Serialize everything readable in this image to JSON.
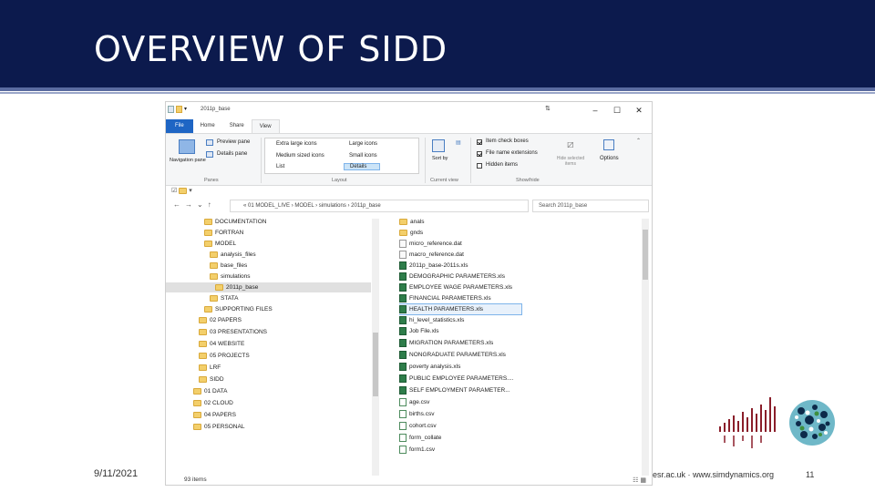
{
  "slide": {
    "title": "OVERVIEW OF SIDD",
    "date": "9/11/2021",
    "footer_text": "esr.ac.uk  ·  www.simdynamics.org",
    "page_number": "11"
  },
  "explorer": {
    "window_title": "2011p_base",
    "window_buttons": [
      "–",
      "☐",
      "✕"
    ],
    "tabs": [
      "File",
      "Home",
      "Share",
      "View"
    ],
    "ribbon": {
      "panes": {
        "navigation_pane": "Navigation pane",
        "preview_pane": "Preview pane",
        "details_pane": "Details pane",
        "group_label": "Panes"
      },
      "layout": {
        "options": [
          "Extra large icons",
          "Large icons",
          "Medium sized icons",
          "Small icons",
          "List",
          "Details"
        ],
        "group_label": "Layout"
      },
      "current_view": {
        "sort": "Sort by",
        "group_label": "Current view"
      },
      "show_hide": {
        "item_check_boxes": "Item check boxes",
        "file_name_extensions": "File name extensions",
        "hidden_items": "Hidden items",
        "hide_selected": "Hide selected items",
        "options": "Options",
        "group_label": "Show/hide"
      }
    },
    "address": "« 01 MODEL_LIVE  ›  MODEL  ›  simulations  ›  2011p_base",
    "search_placeholder": "Search 2011p_base",
    "tree": [
      "DOCUMENTATION",
      "FORTRAN",
      "MODEL",
      "analysis_files",
      "base_files",
      "simulations",
      "2011p_base",
      "STATA",
      "SUPPORTING FILES",
      "02 PAPERS",
      "03 PRESENTATIONS",
      "04 WEBSITE",
      "05 PROJECTS",
      "LRF",
      "SIDD",
      "01 DATA",
      "02 CLOUD",
      "04 PAPERS",
      "05 PERSONAL"
    ],
    "files": [
      "anals",
      "gnds",
      "micro_reference.dat",
      "macro_reference.dat",
      "2011p_base-2011s.xls",
      "DEMOGRAPHIC PARAMETERS.xls",
      "EMPLOYEE WAGE PARAMETERS.xls",
      "FINANCIAL PARAMETERS.xls",
      "HEALTH PARAMETERS.xls",
      "hi_level_statistics.xls",
      "Job File.xls",
      "MIGRATION PARAMETERS.xls",
      "NONGRADUATE PARAMETERS.xls",
      "poverty analysis.xls",
      "PUBLIC EMPLOYEE PARAMETERS....",
      "SELF EMPLOYMENT PARAMETER...",
      "age.csv",
      "births.csv",
      "cohort.csv",
      "form_collate",
      "form1.csv"
    ],
    "selected_file": "HEALTH PARAMETERS.xls",
    "status": "93 items"
  }
}
